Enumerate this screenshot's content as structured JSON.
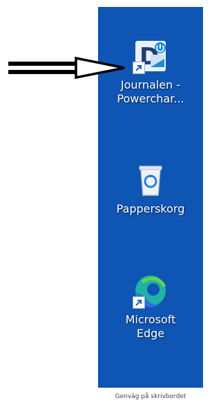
{
  "desktop": {
    "background_color": "#0e55b4",
    "icons": [
      {
        "label_line1": "Journalen -",
        "label_line2": "Powerchar...",
        "icon": "journalen-powerchart-app-icon",
        "shortcut": true
      },
      {
        "label_line1": "Papperskorg",
        "label_line2": "",
        "icon": "recycle-bin-icon",
        "shortcut": false
      },
      {
        "label_line1": "Microsoft",
        "label_line2": "Edge",
        "icon": "microsoft-edge-icon",
        "shortcut": true
      }
    ]
  },
  "caption": "Genväg på skrivbordet",
  "annotation": {
    "icon": "pointing-arrow-icon",
    "color": "#000000"
  }
}
